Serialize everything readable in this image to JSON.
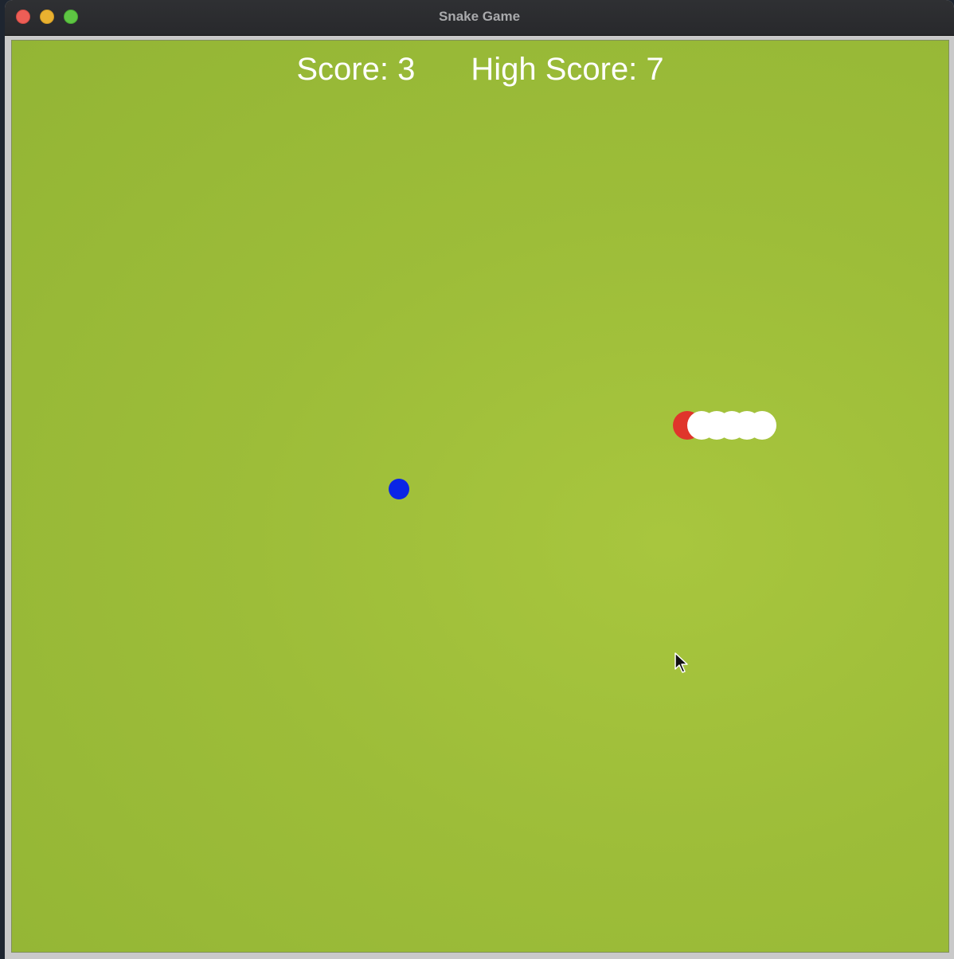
{
  "window": {
    "title": "Snake Game"
  },
  "hud": {
    "score_text": "Score: 3",
    "high_score_text": "High Score: 7"
  },
  "colors": {
    "field": "#9dbd39",
    "snake_head": "#e0352b",
    "snake_body": "#ffffff",
    "food": "#0a25e6",
    "hud_text": "#ffffff"
  },
  "snake": {
    "head_color": "#e0352b",
    "body_color": "#ffffff",
    "body_segment_count": 5
  },
  "food": {
    "color": "#0a25e6"
  },
  "icons": {
    "close": "close-icon",
    "minimize": "minimize-icon",
    "maximize": "maximize-icon",
    "cursor": "mouse-pointer-icon"
  }
}
